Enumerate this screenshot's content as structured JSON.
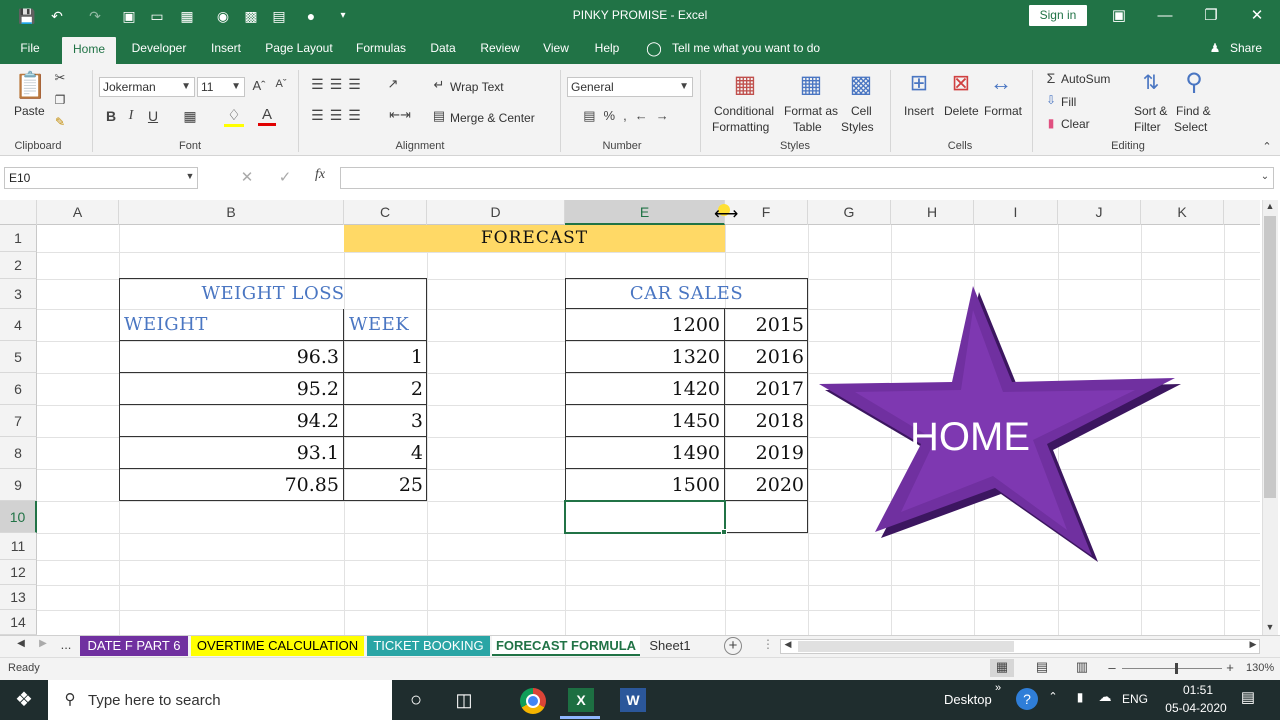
{
  "window": {
    "title": "PINKY PROMISE  -  Excel",
    "signin": "Sign in"
  },
  "tabs": [
    "File",
    "Home",
    "Developer",
    "Insert",
    "Page Layout",
    "Formulas",
    "Data",
    "Review",
    "View",
    "Help"
  ],
  "tell_me": "Tell me what you want to do",
  "share": "Share",
  "ribbon": {
    "paste": "Paste",
    "font_name": "Jokerman",
    "font_size": "11",
    "wrap_text": "Wrap Text",
    "merge_center": "Merge & Center",
    "number_format": "General",
    "conditional": "Conditional",
    "formatting": "Formatting",
    "format_as": "Format as",
    "table": "Table",
    "cell": "Cell",
    "styles": "Styles",
    "insert": "Insert",
    "delete": "Delete",
    "format": "Format",
    "autosum": "AutoSum",
    "fill": "Fill",
    "clear": "Clear",
    "sort_filter_1": "Sort &",
    "sort_filter_2": "Filter",
    "find_select_1": "Find &",
    "find_select_2": "Select",
    "groups": {
      "clipboard": "Clipboard",
      "font": "Font",
      "alignment": "Alignment",
      "number": "Number",
      "styles": "Styles",
      "cells": "Cells",
      "editing": "Editing"
    }
  },
  "formula_bar": {
    "name_box": "E10",
    "fx": "fx",
    "value": ""
  },
  "columns": [
    "A",
    "B",
    "C",
    "D",
    "E",
    "F",
    "G",
    "H",
    "I",
    "J",
    "K"
  ],
  "rows": [
    "1",
    "2",
    "3",
    "4",
    "5",
    "6",
    "7",
    "8",
    "9",
    "10",
    "11",
    "12",
    "13",
    "14"
  ],
  "sheet": {
    "forecast_title": "FORECAST",
    "weight_loss": {
      "title": "WEIGHT LOSS",
      "headers": [
        "WEIGHT",
        "WEEK"
      ],
      "rows": [
        [
          "96.3",
          "1"
        ],
        [
          "95.2",
          "2"
        ],
        [
          "94.2",
          "3"
        ],
        [
          "93.1",
          "4"
        ],
        [
          "70.85",
          "25"
        ]
      ]
    },
    "car_sales": {
      "title": "CAR SALES",
      "rows": [
        [
          "1200",
          "2015"
        ],
        [
          "1320",
          "2016"
        ],
        [
          "1420",
          "2017"
        ],
        [
          "1450",
          "2018"
        ],
        [
          "1490",
          "2019"
        ],
        [
          "1500",
          "2020"
        ]
      ]
    },
    "star_label": "HOME"
  },
  "sheet_tabs": [
    {
      "label": "DATE F PART 6",
      "color": "#7030a0",
      "text": "#ffffff"
    },
    {
      "label": "OVERTIME CALCULATION",
      "color": "#ffff00",
      "text": "#000000"
    },
    {
      "label": "TICKET BOOKING",
      "color": "#2aa5a5",
      "text": "#ffffff"
    },
    {
      "label": "FORECAST FORMULA",
      "color": "#ffffff",
      "text": "#217346"
    },
    {
      "label": "Sheet1",
      "color": "#f3f3f3",
      "text": "#333333"
    }
  ],
  "status": {
    "ready": "Ready",
    "zoom": "130%"
  },
  "taskbar": {
    "search": "Type here to search",
    "desktop": "Desktop",
    "lang": "ENG",
    "time": "01:51",
    "date": "05-04-2020"
  },
  "colors": {
    "excel_green": "#217346",
    "forecast_fill": "#ffd966",
    "star": "#7030a0"
  }
}
